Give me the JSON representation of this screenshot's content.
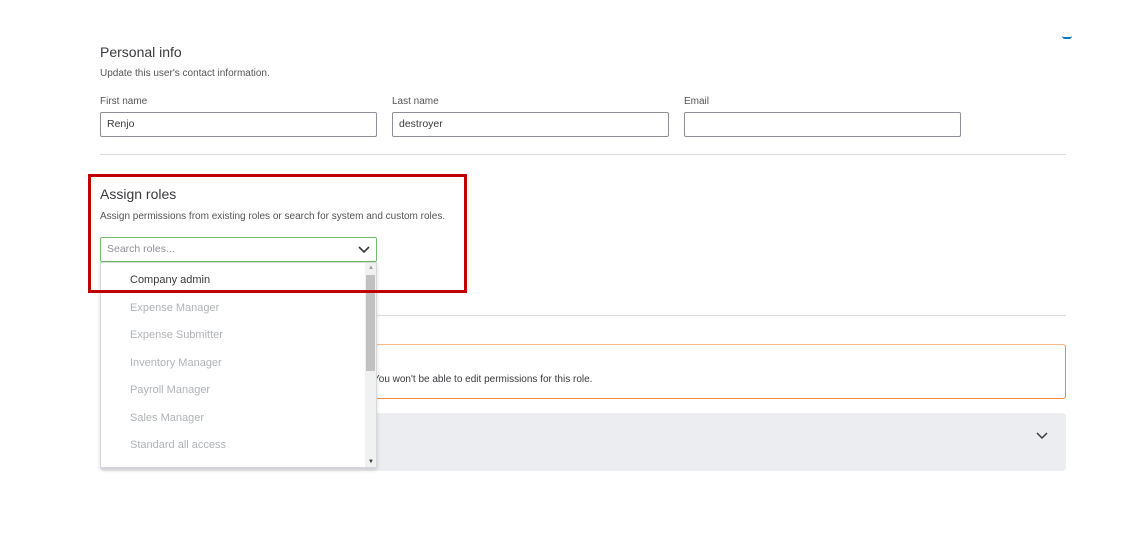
{
  "personal": {
    "title": "Personal info",
    "subtitle": "Update this user's contact information.",
    "first_label": "First name",
    "first_value": "Renjo",
    "last_label": "Last name",
    "last_value": "destroyer",
    "email_label": "Email",
    "email_value": ""
  },
  "roles": {
    "title": "Assign roles",
    "subtitle": "Assign permissions from existing roles or search for system and custom roles.",
    "search_placeholder": "Search roles...",
    "options": [
      "Company admin",
      "Expense Manager",
      "Expense Submitter",
      "Inventory Manager",
      "Payroll Manager",
      "Sales Manager",
      "Standard all access"
    ]
  },
  "alert": {
    "text": "You won't be able to edit permissions for this role."
  },
  "colors": {
    "highlight": "#c00000",
    "focus": "#6cc067",
    "alert_border": "#f5883f"
  }
}
